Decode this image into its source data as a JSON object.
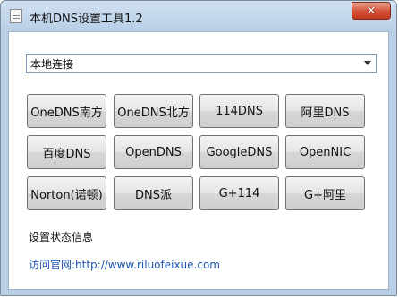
{
  "window": {
    "title": "本机DNS设置工具1.2",
    "close_label": "✕"
  },
  "select": {
    "value": "本地连接"
  },
  "buttons": [
    [
      "OneDNS南方",
      "OneDNS北方",
      "114DNS",
      "阿里DNS"
    ],
    [
      "百度DNS",
      "OpenDNS",
      "GoogleDNS",
      "OpenNIC"
    ],
    [
      "Norton(诺顿)",
      "DNS派",
      "G+114",
      "G+阿里"
    ]
  ],
  "status_text": "设置状态信息",
  "website_link": "访问官网:http://www.riluofeixue.com"
}
